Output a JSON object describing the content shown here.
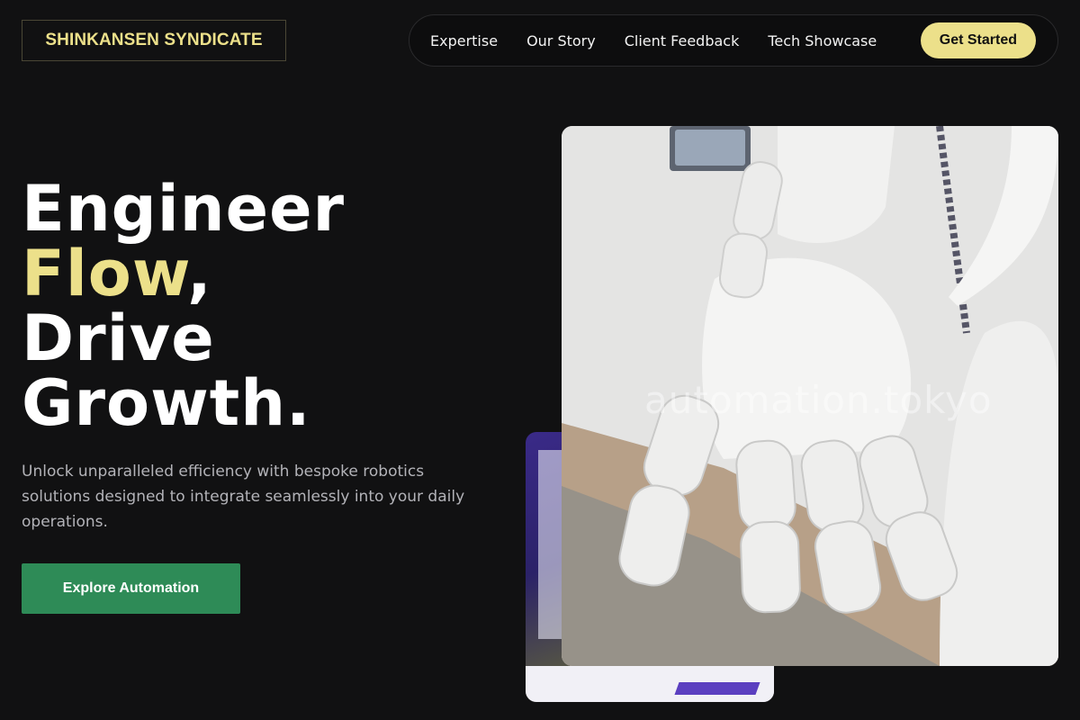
{
  "brand": {
    "name": "SHINKANSEN SYNDICATE",
    "accent_color": "#ece08a",
    "cta_color": "#2e8b57",
    "background_color": "#111112"
  },
  "nav": {
    "items": [
      {
        "label": "Expertise"
      },
      {
        "label": "Our Story"
      },
      {
        "label": "Client Feedback"
      },
      {
        "label": "Tech Showcase"
      }
    ],
    "cta_label": "Get Started"
  },
  "hero": {
    "headline_line1": "Engineer",
    "headline_accent": "Flow",
    "headline_comma": ",",
    "headline_line3": "Drive",
    "headline_line4": "Growth.",
    "subtext": "Unlock unparalleled efficiency with bespoke robotics solutions designed to integrate seamlessly into your daily operations.",
    "button_label": "Explore Automation"
  },
  "images": {
    "main_watermark": "automation.tokyo",
    "main_icon": "robot-hand-image",
    "secondary_icon": "robotics-lab-image"
  }
}
